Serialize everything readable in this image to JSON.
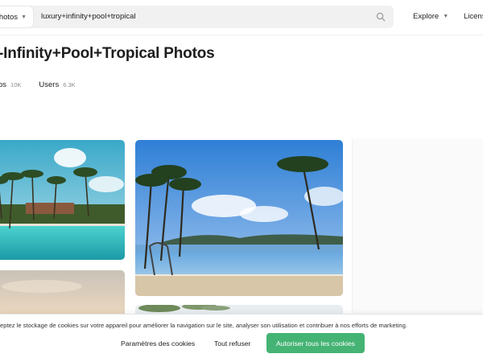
{
  "header": {
    "search_type_label": "hotos",
    "search_query": "luxury+infinity+pool+tropical",
    "nav": {
      "explore_label": "Explore",
      "license_label": "Licens"
    },
    "icons": {
      "search": "search-icon",
      "dropdown": "chevron-down-icon"
    }
  },
  "main": {
    "title": "-Infinity+Pool+Tropical Photos",
    "tabs": [
      {
        "label": "os",
        "count": "10K"
      },
      {
        "label": "Users",
        "count": "6.3K"
      }
    ],
    "photos": [
      {
        "alt": "resort pool with palm trees"
      },
      {
        "alt": "infinity pool overlooking sea with palm trees"
      },
      {
        "alt": "sunset sky"
      },
      {
        "alt": "palm trees"
      }
    ]
  },
  "cookie_banner": {
    "text": "eptez le stockage de cookies sur votre appareil pour améliorer la navigation sur le site, analyser son utilisation et contribuer à nos efforts de marketing.",
    "settings_label": "Paramètres des cookies",
    "refuse_label": "Tout refuser",
    "accept_label": "Autoriser tous les cookies",
    "accept_color": "#45b374"
  }
}
